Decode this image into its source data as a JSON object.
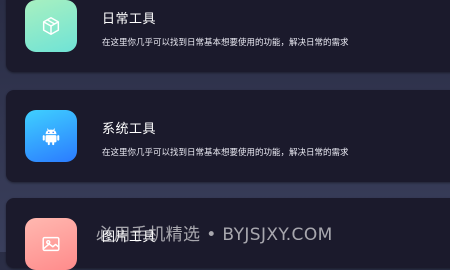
{
  "tools": [
    {
      "title": "日常工具",
      "description": "在这里你几乎可以找到日常基本想要使用的功能，解决日常的需求",
      "icon": "box-icon",
      "gradient": [
        "#a8f0c0",
        "#6fe3d6"
      ]
    },
    {
      "title": "系统工具",
      "description": "在这里你几乎可以找到日常基本想要使用的功能，解决日常的需求",
      "icon": "android-icon",
      "gradient": [
        "#3fd0ff",
        "#2b7bff"
      ]
    },
    {
      "title": "图片工具",
      "icon": "image-icon",
      "gradient": [
        "#ffb8b0",
        "#ff8b8b"
      ]
    }
  ],
  "watermark": "必用手机精选 • BYJSJXY.COM",
  "colors": {
    "background": "#2a2d45",
    "card": "#1b1a2c",
    "text": "#ffffff"
  }
}
